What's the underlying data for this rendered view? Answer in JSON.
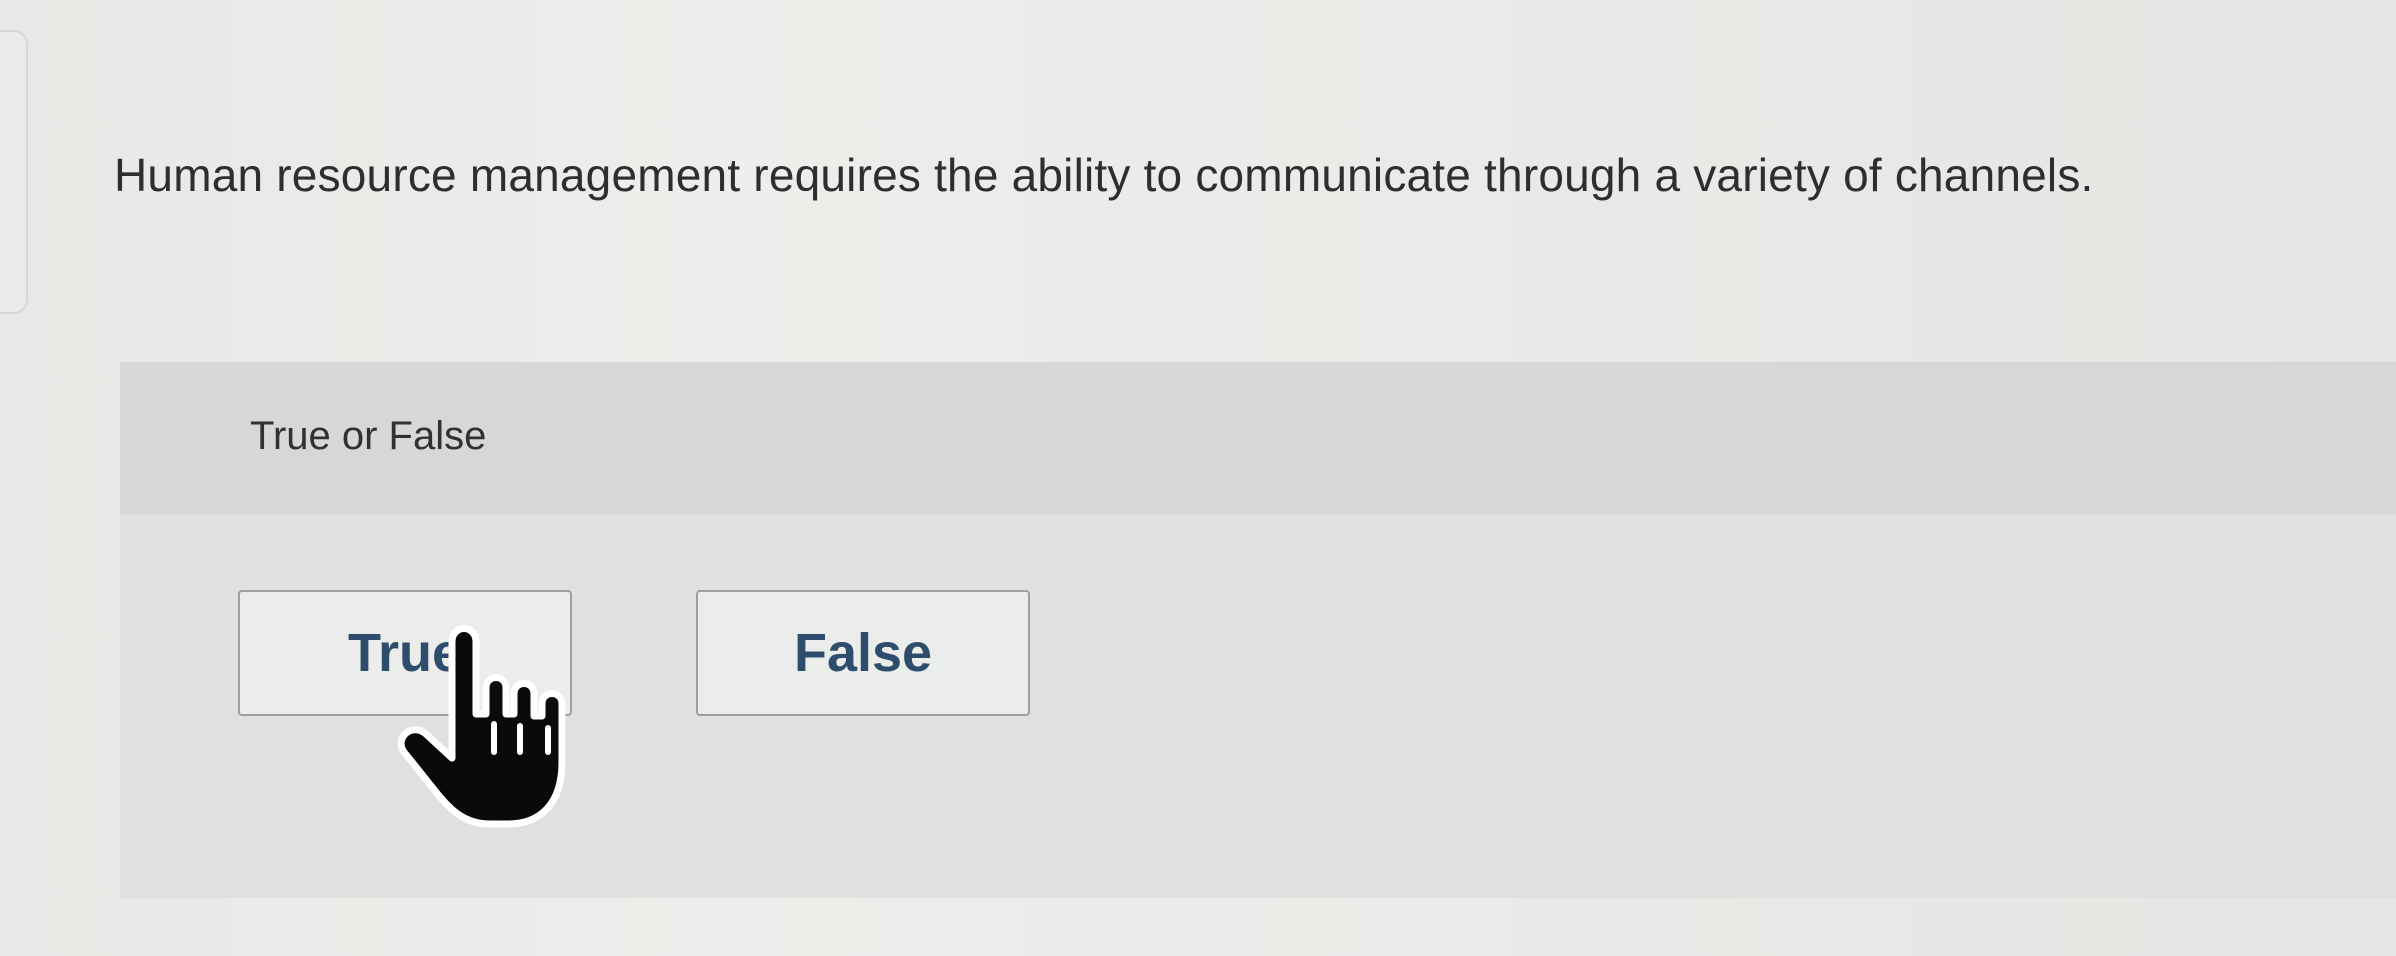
{
  "question": {
    "text": "Human resource management requires the ability to communicate through a variety of channels."
  },
  "answer_panel": {
    "prompt": "True or False",
    "options": [
      {
        "label": "True"
      },
      {
        "label": "False"
      }
    ]
  },
  "cursor": {
    "icon": "pointer-hand-icon"
  },
  "colors": {
    "button_text": "#2e4d6d",
    "panel_background": "#dfe1de",
    "panel_header": "#d6d8d5"
  }
}
